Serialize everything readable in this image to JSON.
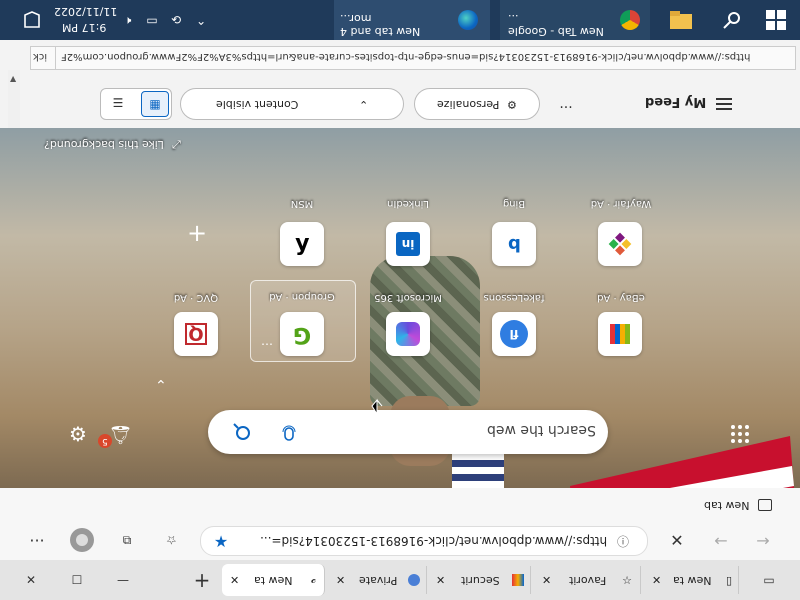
{
  "taskbar": {
    "time": "9:17 PM",
    "date": "11/11/2022",
    "window_buttons": [
      {
        "label": "New tab and 4 mor..."
      },
      {
        "label": "New Tab - Google ..."
      }
    ]
  },
  "browser": {
    "tabs": [
      {
        "label": "New ta"
      },
      {
        "label": "Favorit"
      },
      {
        "label": "Securit"
      },
      {
        "label": "Private"
      },
      {
        "label": "New ta"
      }
    ],
    "url": "https://www.dpbolvw.net/click-9168913-15230314?sid=...",
    "favorites_item": "New tab",
    "status_url": "https://www.dpbolvw.net/click-9168913-15230314?sid=enus-edge-ntp-topsites-curate-ana&url=https%3A%2F%2Fwww.groupon.com%2F",
    "status_tail": "ick"
  },
  "newtab": {
    "my_feed": "My Feed",
    "personalize": "Personalize",
    "content_visible": "Content visible",
    "like_background": "Like this background?",
    "search_placeholder": "Search the web",
    "notification_count": "5",
    "more": "...",
    "top_sites_row1": [
      {
        "label": "Wayfair · Ad",
        "icon": "wayfair-icon"
      },
      {
        "label": "Bing",
        "icon": "bing-icon"
      },
      {
        "label": "LinkedIn",
        "icon": "linkedin-icon"
      },
      {
        "label": "MSN",
        "icon": "msn-icon"
      }
    ],
    "top_sites_row2": [
      {
        "label": "eBay · Ad",
        "icon": "ebay-icon"
      },
      {
        "label": "fakeLessons",
        "icon": "fakelessons-icon"
      },
      {
        "label": "Microsoft 365",
        "icon": "microsoft365-icon"
      },
      {
        "label": "Groupon · Ad",
        "icon": "groupon-icon"
      },
      {
        "label": "QVC · Ad",
        "icon": "qvc-icon"
      }
    ]
  },
  "colors": {
    "taskbar": "#1f3a5a",
    "accent": "#0b66c3",
    "badge": "#d9472b"
  }
}
